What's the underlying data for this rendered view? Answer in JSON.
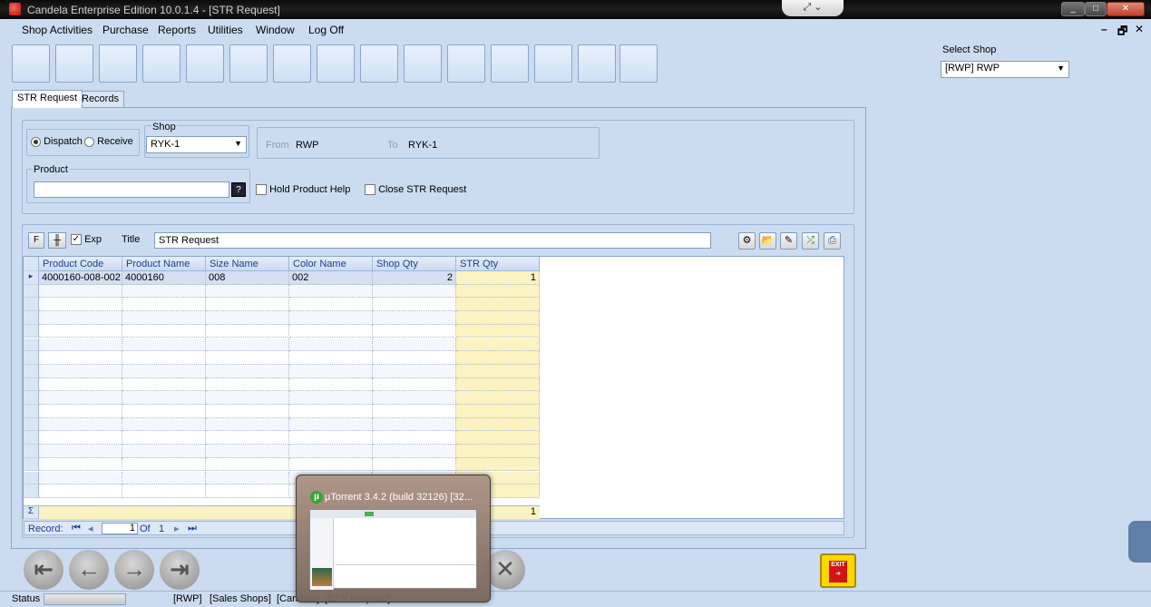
{
  "window": {
    "title": "Candela Enterprise Edition 10.0.1.4 - [STR Request]"
  },
  "menu": [
    "Shop Activities",
    "Purchase",
    "Reports",
    "Utilities",
    "Window",
    "Log Off"
  ],
  "select_shop": {
    "label": "Select Shop",
    "value": "[RWP]  RWP"
  },
  "tabs": [
    "STR Request",
    "Records"
  ],
  "form": {
    "dispatch_label": "Dispatch",
    "receive_label": "Receive",
    "shop_label": "Shop",
    "shop_value": "RYK-1",
    "from_label": "From",
    "from_value": "RWP",
    "to_label": "To",
    "to_value": "RYK-1",
    "product_label": "Product",
    "product_value": "",
    "hold_product_help": "Hold Product Help",
    "close_str_request": "Close STR Request"
  },
  "grid_toolbar": {
    "f_label": "F",
    "exp_label": "Exp",
    "title_label": "Title",
    "title_value": "STR Request"
  },
  "grid": {
    "columns": [
      "Product Code",
      "Product Name",
      "Size Name",
      "Color Name",
      "Shop Qty",
      "STR Qty"
    ],
    "rows": [
      [
        "4000160-008-002",
        "4000160",
        "008",
        "002",
        "2",
        "1"
      ]
    ],
    "total_str_qty": "1",
    "sigma": "Σ"
  },
  "record_nav": {
    "label": "Record:",
    "current": "1",
    "of_label": "Of",
    "total": "1"
  },
  "exit_label": "EXIT",
  "status": {
    "label": "Status",
    "items": [
      "[RWP]",
      "[Sales Shops]",
      "[Candela]",
      "[STR Request]"
    ]
  },
  "taskbar_thumb": {
    "title": "µTorrent 3.4.2  (build 32126) [32..."
  }
}
